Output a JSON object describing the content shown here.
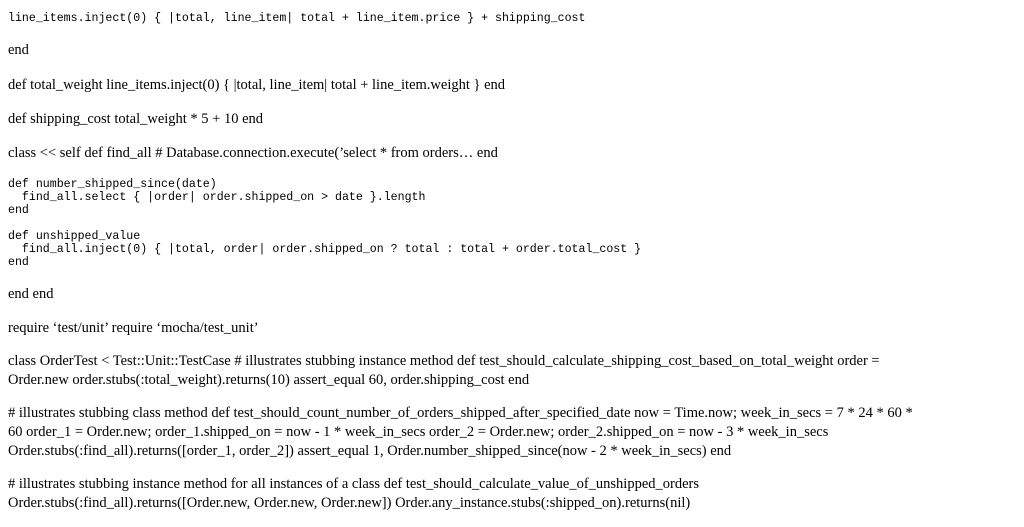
{
  "document": {
    "line_01": "line_items.inject(0) { |total, line_item| total + line_item.price } + shipping_cost",
    "line_02": "end",
    "line_03": "def total_weight line_items.inject(0) { |total, line_item| total + line_item.weight } end",
    "line_04": "def shipping_cost total_weight * 5 + 10 end",
    "line_05": "class << self def find_all # Database.connection.execute(’select * from orders… end",
    "block_number_shipped": "def number_shipped_since(date)\n  find_all.select { |order| order.shipped_on > date }.length\nend",
    "block_unshipped_value": "def unshipped_value\n  find_all.inject(0) { |total, order| order.shipped_on ? total : total + order.total_cost }\nend",
    "line_06": "end end",
    "line_07": "require ‘test/unit’ require ‘mocha/test_unit’",
    "para_1": [
      "class OrderTest < Test::Unit::TestCase # illustrates stubbing instance method def test_should_calculate_shipping_cost_based_on_total_weight order =",
      "Order.new order.stubs(:total_weight).returns(10) assert_equal 60, order.shipping_cost end"
    ],
    "para_2": [
      "# illustrates stubbing class method def test_should_count_number_of_orders_shipped_after_specified_date now = Time.now; week_in_secs = 7 * 24 * 60 *",
      "60 order_1 = Order.new; order_1.shipped_on = now - 1 * week_in_secs order_2 = Order.new; order_2.shipped_on = now - 3 * week_in_secs",
      "Order.stubs(:find_all).returns([order_1, order_2]) assert_equal 1, Order.number_shipped_since(now - 2 * week_in_secs) end"
    ],
    "para_3": [
      "# illustrates stubbing instance method for all instances of a class def test_should_calculate_value_of_unshipped_orders",
      "Order.stubs(:find_all).returns([Order.new, Order.new, Order.new]) Order.any_instance.stubs(:shipped_on).returns(nil)"
    ]
  }
}
